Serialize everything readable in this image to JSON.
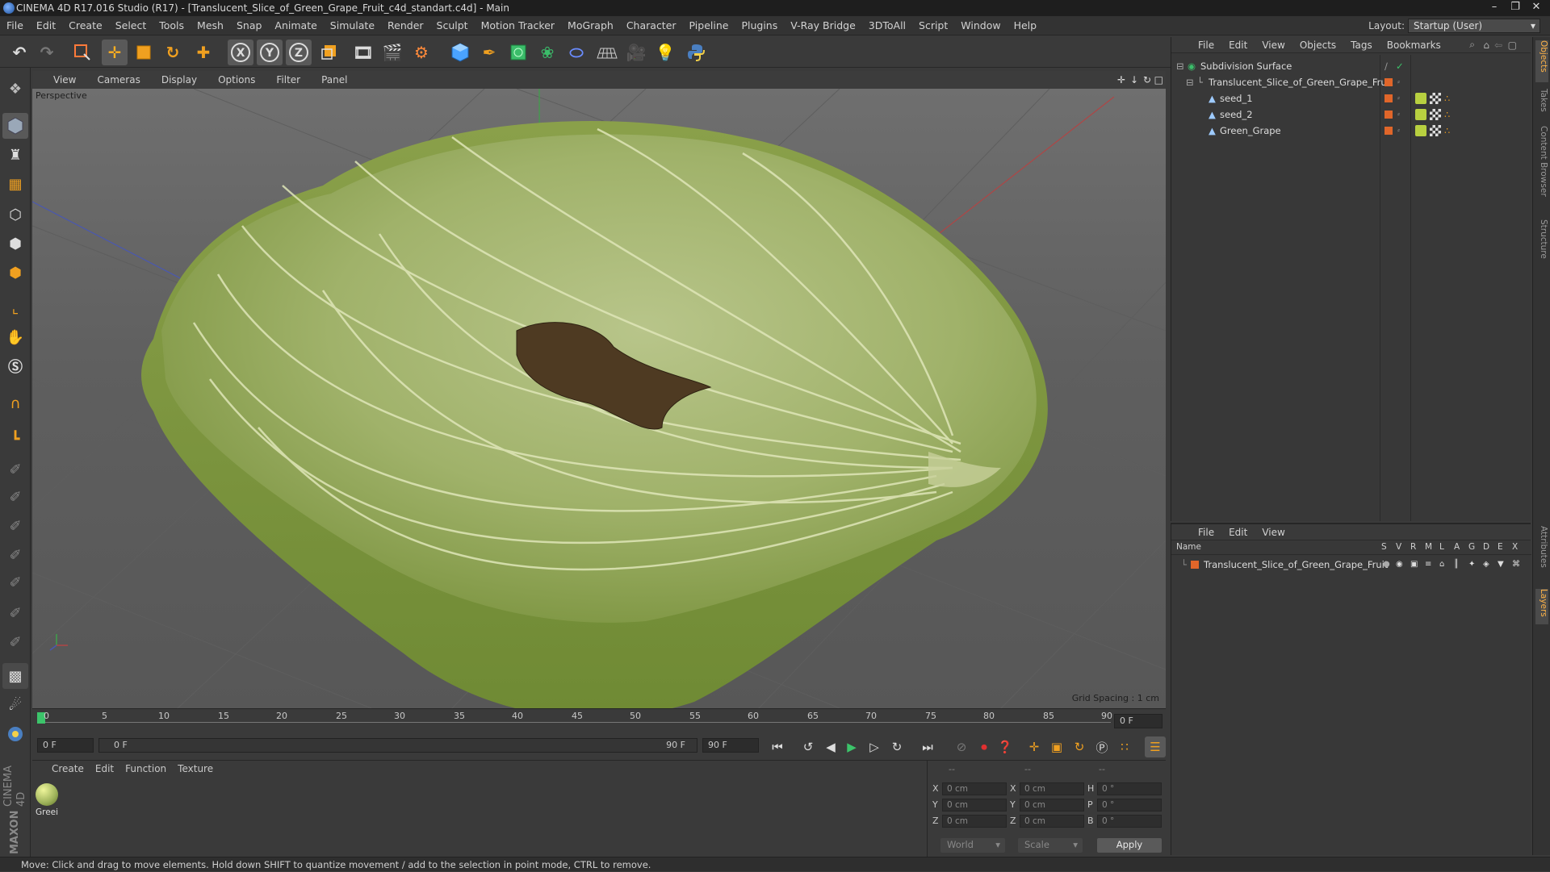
{
  "window": {
    "title": "CINEMA 4D R17.016 Studio (R17) - [Translucent_Slice_of_Green_Grape_Fruit_c4d_standart.c4d] - Main",
    "controls": [
      "minimize-icon",
      "restore-icon",
      "close-icon"
    ]
  },
  "menubar": {
    "items": [
      "File",
      "Edit",
      "Create",
      "Select",
      "Tools",
      "Mesh",
      "Snap",
      "Animate",
      "Simulate",
      "Render",
      "Sculpt",
      "Motion Tracker",
      "MoGraph",
      "Character",
      "Pipeline",
      "Plugins",
      "V-Ray Bridge",
      "3DToAll",
      "Script",
      "Window",
      "Help"
    ],
    "layout_label": "Layout:",
    "layout_value": "Startup (User)"
  },
  "toolbar": {
    "icons": [
      "undo-icon",
      "redo-icon",
      "live-selection-icon",
      "move-icon",
      "scale-icon",
      "rotate-icon",
      "create-object-icon",
      "x-axis-icon",
      "y-axis-icon",
      "z-axis-icon",
      "world-coords-icon",
      "render-view-icon",
      "render-picture-viewer-icon",
      "edit-render-settings-icon",
      "cube-icon",
      "pen-spline-icon",
      "subdivision-icon",
      "array-icon",
      "deformer-icon",
      "floor-icon",
      "camera-icon",
      "light-icon",
      "python-icon"
    ],
    "axis_x": "X",
    "axis_y": "Y",
    "axis_z": "Z"
  },
  "viewport": {
    "menu": [
      "View",
      "Cameras",
      "Display",
      "Options",
      "Filter",
      "Panel"
    ],
    "label": "Perspective",
    "grid_spacing": "Grid Spacing : 1 cm"
  },
  "timeline": {
    "ticks": [
      "0",
      "5",
      "10",
      "15",
      "20",
      "25",
      "30",
      "35",
      "40",
      "45",
      "50",
      "55",
      "60",
      "65",
      "70",
      "75",
      "80",
      "85",
      "90"
    ],
    "current_frame": "0 F",
    "start_field": "0 F",
    "range_start": "0 F",
    "range_end": "90 F",
    "end_field": "90 F"
  },
  "material_panel": {
    "menu": [
      "Create",
      "Edit",
      "Function",
      "Texture"
    ],
    "materials": [
      {
        "name": "Greei"
      }
    ]
  },
  "coord_panel": {
    "headers": [
      "--",
      "--",
      "--"
    ],
    "rows": [
      {
        "l1": "X",
        "v1": "0 cm",
        "l2": "X",
        "v2": "0 cm",
        "l3": "H",
        "v3": "0 °"
      },
      {
        "l1": "Y",
        "v1": "0 cm",
        "l2": "Y",
        "v2": "0 cm",
        "l3": "P",
        "v3": "0 °"
      },
      {
        "l1": "Z",
        "v1": "0 cm",
        "l2": "Z",
        "v2": "0 cm",
        "l3": "B",
        "v3": "0 °"
      }
    ],
    "mode": "World",
    "transform": "Scale",
    "apply": "Apply"
  },
  "object_manager": {
    "menu": [
      "File",
      "Edit",
      "View",
      "Objects",
      "Tags",
      "Bookmarks"
    ],
    "objects": [
      {
        "name": "Subdivision Surface",
        "indent": 0
      },
      {
        "name": "Translucent_Slice_of_Green_Grape_Fruit",
        "indent": 1
      },
      {
        "name": "seed_1",
        "indent": 2
      },
      {
        "name": "seed_2",
        "indent": 2
      },
      {
        "name": "Green_Grape",
        "indent": 2
      }
    ]
  },
  "layer_manager": {
    "menu": [
      "File",
      "Edit",
      "View"
    ],
    "columns": [
      "Name",
      "S",
      "V",
      "R",
      "M",
      "L",
      "A",
      "G",
      "D",
      "E",
      "X"
    ],
    "layers": [
      {
        "name": "Translucent_Slice_of_Green_Grape_Fruit",
        "color": "#e0662a"
      }
    ]
  },
  "side_tabs": [
    "Objects",
    "Takes",
    "Content Browser",
    "Structure",
    "Attributes",
    "Layers"
  ],
  "branding": {
    "maxon": "MAXON",
    "cinema": "CINEMA 4D"
  },
  "status": "Move: Click and drag to move elements. Hold down SHIFT to quantize movement / add to the selection in point mode, CTRL to remove.",
  "colors": {
    "accent_orange": "#e0662a",
    "selection_blue": "#3d7fd6",
    "grape_green": "#9db25a",
    "seed_brown": "#4e3a22"
  }
}
